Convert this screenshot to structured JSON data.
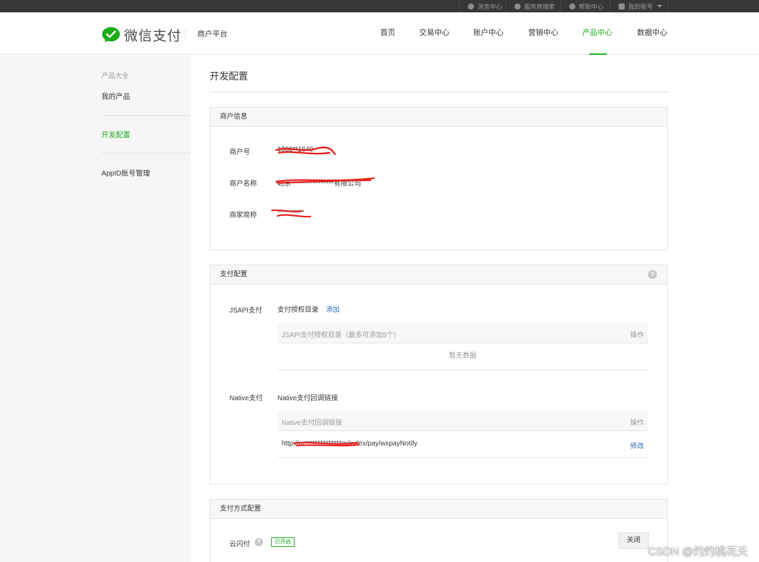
{
  "topbar": {
    "messages": "消息中心",
    "service_search": "服务商搜索",
    "help": "帮助中心",
    "account": "我的账号"
  },
  "header": {
    "logo_text": "微信支付",
    "platform": "商户平台",
    "nav": [
      "首页",
      "交易中心",
      "账户中心",
      "营销中心",
      "产品中心",
      "数据中心"
    ],
    "active_nav": "产品中心"
  },
  "sidebar": {
    "category": "产品大全",
    "my_products": "我的产品",
    "dev_config": "开发配置",
    "appid_mgmt": "AppID账号管理"
  },
  "main": {
    "title": "开发配置",
    "merchant_info": {
      "header": "商户信息",
      "fields": [
        {
          "label": "商户号",
          "value": "1600**1640"
        },
        {
          "label": "商户名称",
          "value": "北京****************有限公司"
        },
        {
          "label": "商家简称",
          "value": "**********"
        }
      ]
    },
    "pay_config": {
      "header": "支付配置",
      "help": "?",
      "jsapi": {
        "label": "JSAPI支付",
        "sub_title": "支付授权目录",
        "add_link": "添加",
        "table_header": "JSAPI支付授权目录（最多可添加5个）",
        "table_action": "操作",
        "empty": "暂无数据"
      },
      "native": {
        "label": "Native支付",
        "sub_title": "Native支付回调链接",
        "table_header": "Native支付回调链接",
        "table_action": "操作",
        "url": "http://m**************m/index/pay/wxpayNotify",
        "edit": "修改"
      }
    },
    "pay_method": {
      "header": "支付方式配置",
      "item_label": "云闪付",
      "help": "?",
      "status": "已开启",
      "close_btn": "关闭"
    }
  },
  "watermark": "CSDN @灼灼桃花夭",
  "colors": {
    "brand_green": "#1aad19",
    "link_blue": "#2e6bb5",
    "redaction_red": "#e8201a"
  }
}
